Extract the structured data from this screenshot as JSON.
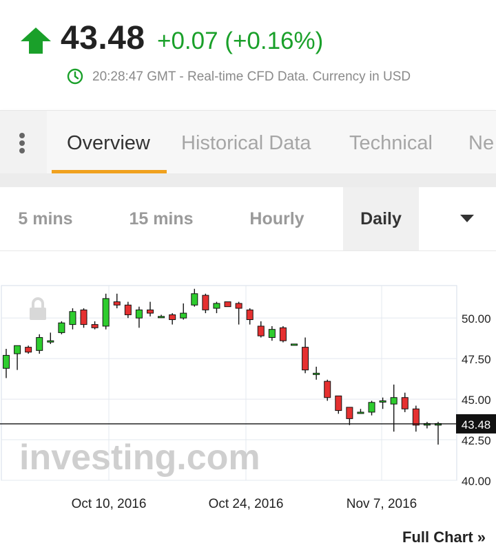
{
  "quote": {
    "price": "43.48",
    "change": "+0.07 (+0.16%)",
    "direction": "up",
    "status": "20:28:47 GMT - Real-time CFD Data. Currency in USD",
    "up_color": "#1aa02a"
  },
  "tabs": [
    {
      "label": "Overview",
      "active": true
    },
    {
      "label": "Historical Data",
      "active": false
    },
    {
      "label": "Technical",
      "active": false
    },
    {
      "label": "Ne",
      "active": false
    }
  ],
  "timeframes": [
    {
      "label": "5 mins",
      "active": false
    },
    {
      "label": "15 mins",
      "active": false
    },
    {
      "label": "Hourly",
      "active": false
    },
    {
      "label": "Daily",
      "active": true
    }
  ],
  "chart_data": {
    "type": "candlestick",
    "watermark": "investing.com",
    "ylim": [
      40,
      52
    ],
    "y_ticks": [
      40.0,
      42.5,
      45.0,
      47.5,
      50.0
    ],
    "y_tick_labels": [
      "40.00",
      "42.50",
      "45.00",
      "47.50",
      "50.00"
    ],
    "x_tick_labels": [
      "Oct 10, 2016",
      "Oct 24, 2016",
      "Nov 7, 2016"
    ],
    "current_price": 43.48,
    "current_price_label": "43.48",
    "up_color": "#2ecc2e",
    "down_color": "#e53030",
    "candles": [
      {
        "o": 46.9,
        "h": 48.1,
        "l": 46.3,
        "c": 47.7
      },
      {
        "o": 47.8,
        "h": 48.3,
        "l": 46.8,
        "c": 48.3
      },
      {
        "o": 48.2,
        "h": 48.3,
        "l": 47.8,
        "c": 47.9
      },
      {
        "o": 48.0,
        "h": 49.0,
        "l": 47.8,
        "c": 48.8
      },
      {
        "o": 48.6,
        "h": 49.1,
        "l": 48.4,
        "c": 48.6
      },
      {
        "o": 49.1,
        "h": 49.8,
        "l": 49.0,
        "c": 49.7
      },
      {
        "o": 49.6,
        "h": 50.6,
        "l": 49.3,
        "c": 50.4
      },
      {
        "o": 50.5,
        "h": 50.6,
        "l": 49.4,
        "c": 49.6
      },
      {
        "o": 49.6,
        "h": 49.8,
        "l": 49.3,
        "c": 49.4
      },
      {
        "o": 49.5,
        "h": 51.5,
        "l": 49.3,
        "c": 51.2
      },
      {
        "o": 51.0,
        "h": 51.5,
        "l": 50.6,
        "c": 50.8
      },
      {
        "o": 50.8,
        "h": 51.0,
        "l": 50.0,
        "c": 50.2
      },
      {
        "o": 50.0,
        "h": 50.7,
        "l": 49.4,
        "c": 50.5
      },
      {
        "o": 50.5,
        "h": 51.0,
        "l": 50.1,
        "c": 50.3
      },
      {
        "o": 50.1,
        "h": 50.2,
        "l": 50.0,
        "c": 50.1
      },
      {
        "o": 50.2,
        "h": 50.3,
        "l": 49.6,
        "c": 49.9
      },
      {
        "o": 50.0,
        "h": 50.9,
        "l": 49.9,
        "c": 50.3
      },
      {
        "o": 50.8,
        "h": 51.8,
        "l": 50.7,
        "c": 51.5
      },
      {
        "o": 51.4,
        "h": 51.5,
        "l": 50.3,
        "c": 50.5
      },
      {
        "o": 50.6,
        "h": 51.0,
        "l": 50.3,
        "c": 50.9
      },
      {
        "o": 51.0,
        "h": 51.0,
        "l": 50.7,
        "c": 50.7
      },
      {
        "o": 50.9,
        "h": 51.0,
        "l": 49.6,
        "c": 50.6
      },
      {
        "o": 50.5,
        "h": 50.6,
        "l": 49.6,
        "c": 49.9
      },
      {
        "o": 49.5,
        "h": 49.8,
        "l": 48.8,
        "c": 48.9
      },
      {
        "o": 48.8,
        "h": 49.5,
        "l": 48.6,
        "c": 49.3
      },
      {
        "o": 49.4,
        "h": 49.5,
        "l": 48.5,
        "c": 48.6
      },
      {
        "o": 48.4,
        "h": 48.4,
        "l": 48.4,
        "c": 48.4
      },
      {
        "o": 48.2,
        "h": 48.8,
        "l": 46.6,
        "c": 46.8
      },
      {
        "o": 46.6,
        "h": 47.0,
        "l": 46.2,
        "c": 46.6
      },
      {
        "o": 46.1,
        "h": 46.2,
        "l": 44.9,
        "c": 45.1
      },
      {
        "o": 45.2,
        "h": 45.2,
        "l": 44.1,
        "c": 44.3
      },
      {
        "o": 44.5,
        "h": 44.5,
        "l": 43.4,
        "c": 43.8
      },
      {
        "o": 44.2,
        "h": 44.4,
        "l": 44.1,
        "c": 44.2
      },
      {
        "o": 44.2,
        "h": 44.9,
        "l": 44.0,
        "c": 44.8
      },
      {
        "o": 44.9,
        "h": 45.1,
        "l": 44.4,
        "c": 44.9
      },
      {
        "o": 44.7,
        "h": 45.9,
        "l": 43.0,
        "c": 45.1
      },
      {
        "o": 45.1,
        "h": 45.4,
        "l": 44.2,
        "c": 44.4
      },
      {
        "o": 44.4,
        "h": 44.6,
        "l": 43.0,
        "c": 43.4
      },
      {
        "o": 43.4,
        "h": 43.6,
        "l": 43.2,
        "c": 43.5
      },
      {
        "o": 43.4,
        "h": 43.6,
        "l": 42.2,
        "c": 43.5
      }
    ]
  },
  "full_chart_link": "Full Chart »"
}
